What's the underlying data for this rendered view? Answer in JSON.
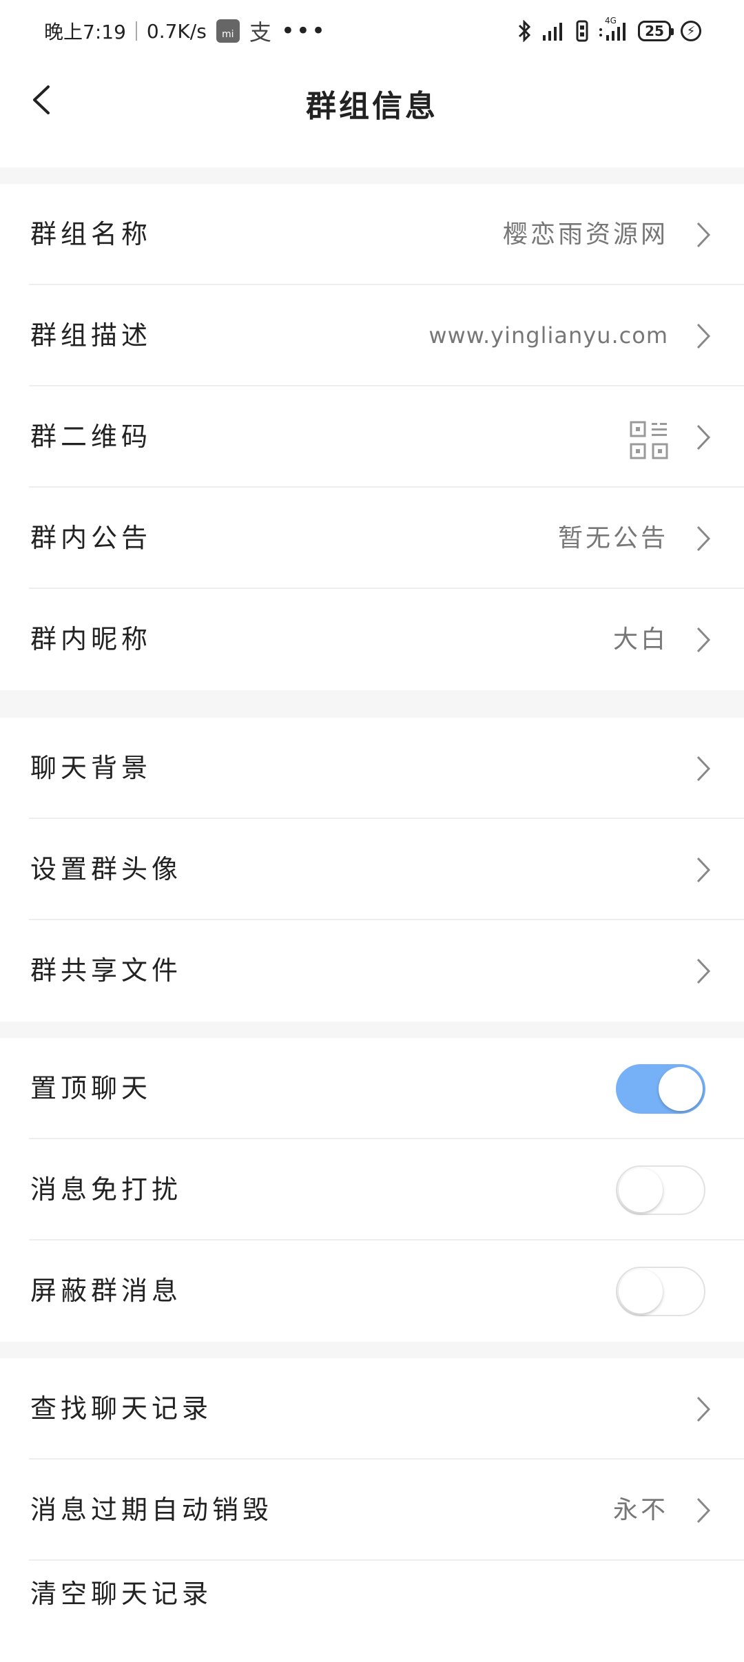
{
  "status_bar": {
    "time": "晚上7:19",
    "speed": "0.7K/s",
    "mi_badge": "mi",
    "alipay": "支",
    "more": "•••",
    "network_type": "4G",
    "battery": "25"
  },
  "header": {
    "title": "群组信息"
  },
  "sections": {
    "info": [
      {
        "label": "群组名称",
        "value": "樱恋雨资源网"
      },
      {
        "label": "群组描述",
        "value": "www.yinglianyu.com"
      },
      {
        "label": "群二维码",
        "value_icon": "qr-code-icon"
      },
      {
        "label": "群内公告",
        "value": "暂无公告"
      },
      {
        "label": "群内昵称",
        "value": "大白"
      }
    ],
    "media": [
      {
        "label": "聊天背景"
      },
      {
        "label": "设置群头像"
      },
      {
        "label": "群共享文件"
      }
    ],
    "toggles": [
      {
        "label": "置顶聊天",
        "on": true
      },
      {
        "label": "消息免打扰",
        "on": false
      },
      {
        "label": "屏蔽群消息",
        "on": false
      }
    ],
    "history": [
      {
        "label": "查找聊天记录"
      },
      {
        "label": "消息过期自动销毁",
        "value": "永不"
      },
      {
        "label": "清空聊天记录"
      }
    ]
  },
  "colors": {
    "toggle_on": "#76b1f7",
    "section_gap": "#f6f6f6"
  }
}
